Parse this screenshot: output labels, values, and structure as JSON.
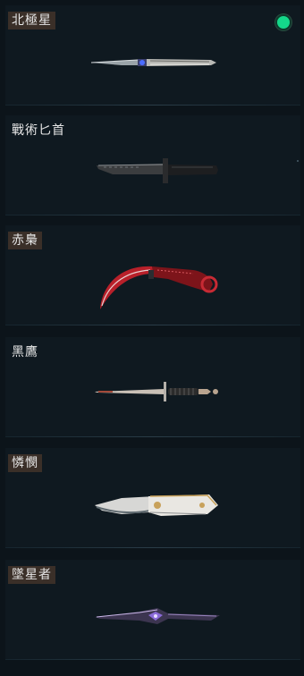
{
  "skins": [
    {
      "name": "北極星",
      "equipped": true,
      "icon": "polaris-knife-icon"
    },
    {
      "name": "戰術匕首",
      "equipped": false,
      "icon": "tactical-knife-icon"
    },
    {
      "name": "赤梟",
      "equipped": false,
      "icon": "karambit-red-icon"
    },
    {
      "name": "黑鷹",
      "equipped": false,
      "icon": "dagger-icon"
    },
    {
      "name": "憐憫",
      "equipped": false,
      "icon": "folding-knife-icon"
    },
    {
      "name": "墜星者",
      "equipped": false,
      "icon": "star-blade-icon"
    }
  ],
  "colors": {
    "equipped_indicator": "#14d88a",
    "label_bg": "#3a2f28",
    "card_bg": "#0f1920"
  }
}
